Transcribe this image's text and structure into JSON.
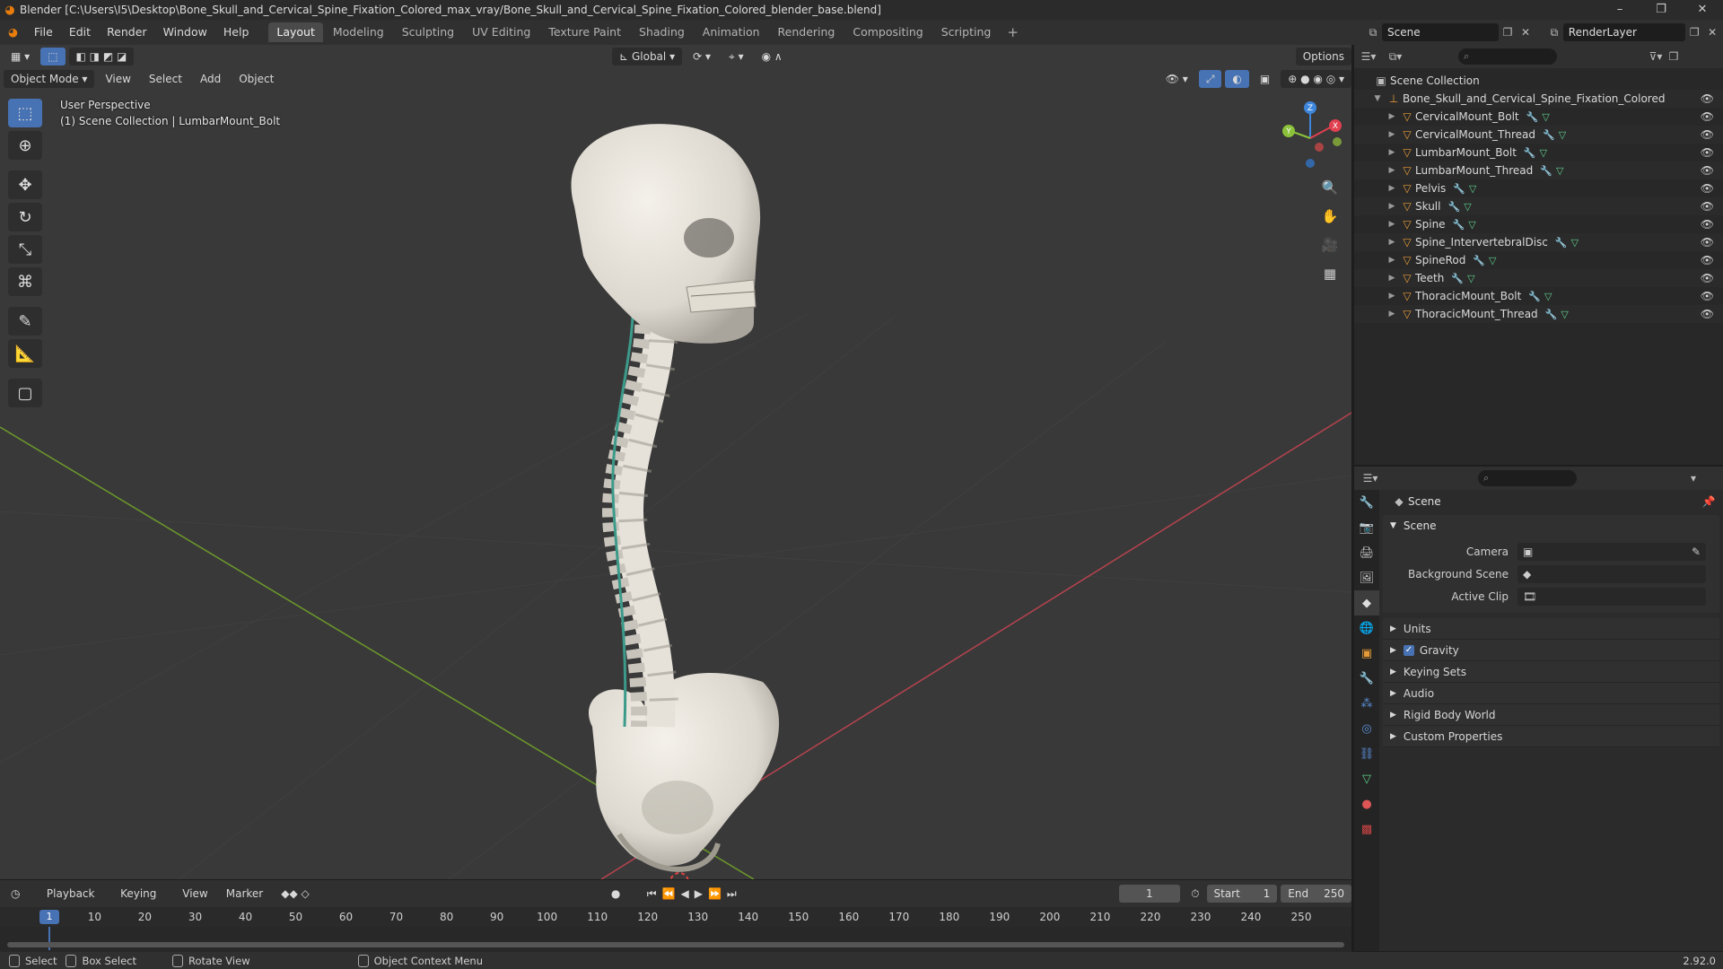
{
  "window": {
    "title": "Blender [C:\\Users\\I5\\Desktop\\Bone_Skull_and_Cervical_Spine_Fixation_Colored_max_vray/Bone_Skull_and_Cervical_Spine_Fixation_Colored_blender_base.blend]",
    "controls": [
      "–",
      "❐",
      "✕"
    ]
  },
  "menubar": {
    "menus": [
      "File",
      "Edit",
      "Render",
      "Window",
      "Help"
    ],
    "workspaces": [
      "Layout",
      "Modeling",
      "Sculpting",
      "UV Editing",
      "Texture Paint",
      "Shading",
      "Animation",
      "Rendering",
      "Compositing",
      "Scripting"
    ],
    "active_workspace": "Layout",
    "scene": "Scene",
    "render_layer": "RenderLayer"
  },
  "viewport": {
    "mode": "Object Mode",
    "menus": [
      "View",
      "Select",
      "Add",
      "Object"
    ],
    "orientation": "Global",
    "options_label": "Options",
    "perspective_label": "User Perspective",
    "collection_label": "(1) Scene Collection | LumbarMount_Bolt",
    "gizmo_axes": [
      "X",
      "Y",
      "Z"
    ],
    "tools": [
      "select-box",
      "cursor",
      "move",
      "rotate",
      "scale",
      "transform",
      "annotate",
      "measure",
      "add-cube"
    ]
  },
  "outliner": {
    "root": "Scene Collection",
    "collection": "Bone_Skull_and_Cervical_Spine_Fixation_Colored",
    "objects": [
      "CervicalMount_Bolt",
      "CervicalMount_Thread",
      "LumbarMount_Bolt",
      "LumbarMount_Thread",
      "Pelvis",
      "Skull",
      "Spine",
      "Spine_IntervertebralDisc",
      "SpineRod",
      "Teeth",
      "ThoracicMount_Bolt",
      "ThoracicMount_Thread"
    ]
  },
  "properties": {
    "context": "Scene",
    "panel": "Scene",
    "fields": [
      {
        "label": "Camera",
        "value": ""
      },
      {
        "label": "Background Scene",
        "value": ""
      },
      {
        "label": "Active Clip",
        "value": ""
      }
    ],
    "collapsed_panels": [
      "Units",
      "Gravity",
      "Keying Sets",
      "Audio",
      "Rigid Body World",
      "Custom Properties"
    ],
    "gravity_checked": true
  },
  "timeline": {
    "menus": [
      "Playback",
      "Keying",
      "View",
      "Marker"
    ],
    "current_frame": "1",
    "start_label": "Start",
    "start": "1",
    "end_label": "End",
    "end": "250",
    "ticks": [
      "10",
      "20",
      "30",
      "40",
      "50",
      "60",
      "70",
      "80",
      "90",
      "100",
      "110",
      "120",
      "130",
      "140",
      "150",
      "160",
      "170",
      "180",
      "190",
      "200",
      "210",
      "220",
      "230",
      "240",
      "250"
    ],
    "playhead": "1"
  },
  "statusbar": {
    "select": "Select",
    "box_select": "Box Select",
    "rotate_view": "Rotate View",
    "context_menu": "Object Context Menu",
    "version": "2.92.0"
  },
  "colors": {
    "accent": "#4772b3",
    "x_axis": "#e0404f",
    "y_axis": "#8bc23a",
    "z_axis": "#3d86dc",
    "object_orange": "#e69a37"
  }
}
